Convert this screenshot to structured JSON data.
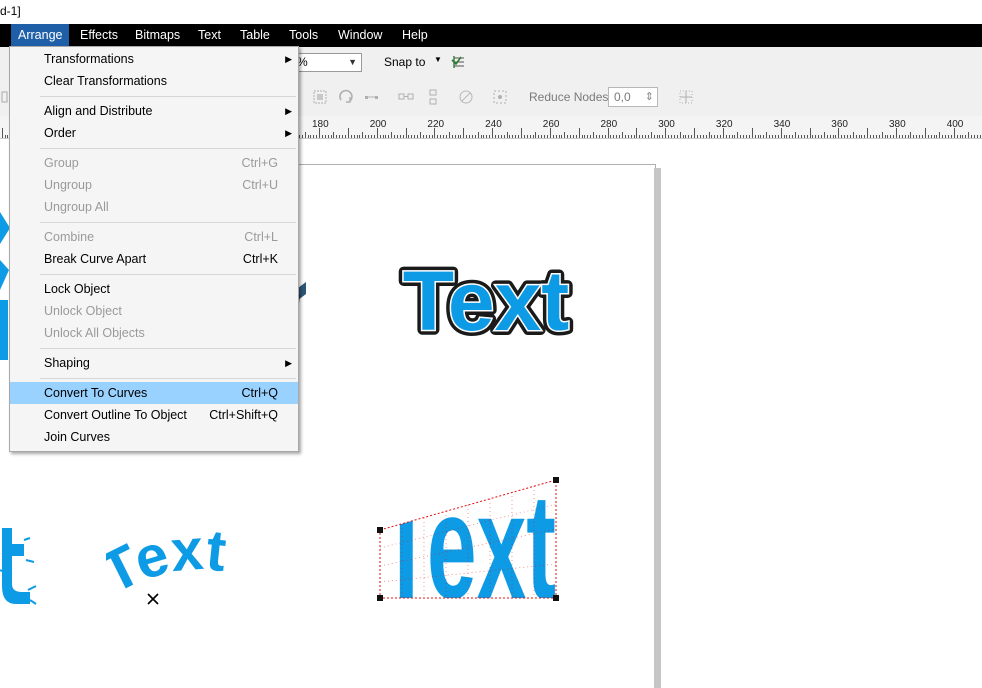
{
  "title_fragment": "d-1]",
  "menubar": {
    "items": [
      {
        "label": "Arrange",
        "active": true
      },
      {
        "label": "Effects",
        "active": false
      },
      {
        "label": "Bitmaps",
        "active": false
      },
      {
        "label": "Text",
        "active": false
      },
      {
        "label": "Table",
        "active": false
      },
      {
        "label": "Tools",
        "active": false
      },
      {
        "label": "Window",
        "active": false
      },
      {
        "label": "Help",
        "active": false
      }
    ]
  },
  "property_bar": {
    "zoom_value": "%",
    "snap_label": "Snap to",
    "reduce_nodes_label": "Reduce Nodes",
    "reduce_nodes_value": "0,0"
  },
  "ruler": {
    "labels": [
      "180",
      "200",
      "220",
      "240",
      "260",
      "280",
      "300",
      "320",
      "340",
      "360",
      "380",
      "400"
    ]
  },
  "arrange_menu": {
    "items": [
      {
        "label": "Transformations",
        "shortcut": "",
        "submenu": true,
        "disabled": false
      },
      {
        "label": "Clear Transformations",
        "shortcut": "",
        "submenu": false,
        "disabled": false
      },
      {
        "label": "Align and Distribute",
        "shortcut": "",
        "submenu": true,
        "disabled": false
      },
      {
        "label": "Order",
        "shortcut": "",
        "submenu": true,
        "disabled": false
      },
      {
        "label": "Group",
        "shortcut": "Ctrl+G",
        "submenu": false,
        "disabled": true
      },
      {
        "label": "Ungroup",
        "shortcut": "Ctrl+U",
        "submenu": false,
        "disabled": true
      },
      {
        "label": "Ungroup All",
        "shortcut": "",
        "submenu": false,
        "disabled": true
      },
      {
        "label": "Combine",
        "shortcut": "Ctrl+L",
        "submenu": false,
        "disabled": true
      },
      {
        "label": "Break Curve Apart",
        "shortcut": "Ctrl+K",
        "submenu": false,
        "disabled": false
      },
      {
        "label": "Lock Object",
        "shortcut": "",
        "submenu": false,
        "disabled": false
      },
      {
        "label": "Unlock Object",
        "shortcut": "",
        "submenu": false,
        "disabled": true
      },
      {
        "label": "Unlock All Objects",
        "shortcut": "",
        "submenu": false,
        "disabled": true
      },
      {
        "label": "Shaping",
        "shortcut": "",
        "submenu": true,
        "disabled": false
      },
      {
        "label": "Convert To Curves",
        "shortcut": "Ctrl+Q",
        "submenu": false,
        "disabled": false,
        "highlighted": true
      },
      {
        "label": "Convert Outline To Object",
        "shortcut": "Ctrl+Shift+Q",
        "submenu": false,
        "disabled": false
      },
      {
        "label": "Join Curves",
        "shortcut": "",
        "submenu": false,
        "disabled": false
      }
    ]
  },
  "canvas": {
    "text_objects": [
      {
        "text": "Text",
        "style": "outlined"
      },
      {
        "text": "Text",
        "style": "arched"
      },
      {
        "text": "Text",
        "style": "envelope-distorted"
      }
    ],
    "colors": {
      "text_blue": "#0d9be6",
      "outline_dark": "#1a1a1a",
      "envelope_red": "#e01010",
      "dark_3d": "#1d3a52"
    }
  }
}
